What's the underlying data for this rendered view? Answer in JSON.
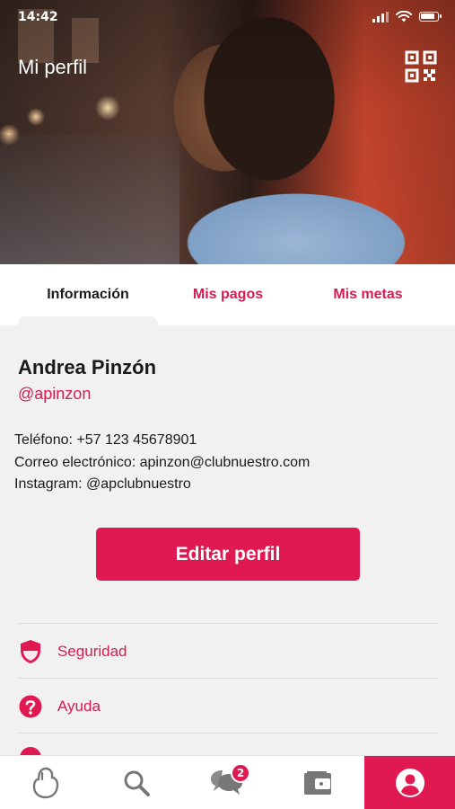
{
  "status_bar": {
    "time": "14:42"
  },
  "header": {
    "title": "Mi perfil",
    "qr_icon": "qr-code-icon"
  },
  "tabs": [
    {
      "label": "Información",
      "active": true
    },
    {
      "label": "Mis pagos",
      "active": false
    },
    {
      "label": "Mis metas",
      "active": false
    }
  ],
  "profile": {
    "name": "Andrea Pinzón",
    "handle": "@apinzon",
    "details": [
      "Teléfono: +57 123 45678901",
      "Correo electrónico: apinzon@clubnuestro.com",
      "Instagram: @apclubnuestro"
    ],
    "edit_label": "Editar perfil"
  },
  "menu": [
    {
      "label": "Seguridad",
      "icon": "shield-icon"
    },
    {
      "label": "Ayuda",
      "icon": "help-icon"
    }
  ],
  "bottom_nav": [
    {
      "icon": "hand-icon",
      "active": false
    },
    {
      "icon": "search-icon",
      "active": false
    },
    {
      "icon": "chat-icon",
      "active": false,
      "badge": "2"
    },
    {
      "icon": "wallet-icon",
      "active": false
    },
    {
      "icon": "user-icon",
      "active": true
    }
  ],
  "colors": {
    "accent": "#e01953",
    "accent_text": "#d81b51",
    "background": "#f1f1f1"
  }
}
